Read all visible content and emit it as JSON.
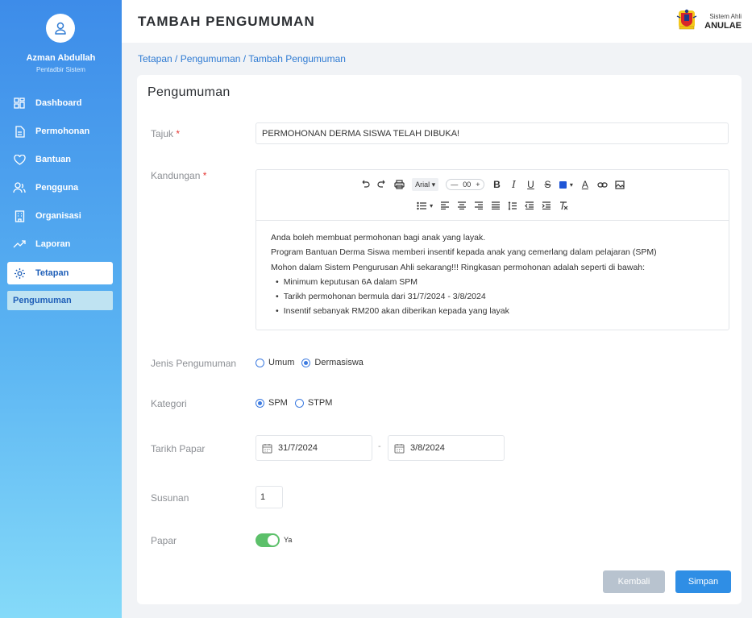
{
  "user": {
    "name": "Azman Abdullah",
    "role": "Pentadbir Sistem"
  },
  "nav": {
    "items": [
      {
        "label": "Dashboard",
        "icon": "dashboard-icon"
      },
      {
        "label": "Permohonan",
        "icon": "document-icon"
      },
      {
        "label": "Bantuan",
        "icon": "heart-icon"
      },
      {
        "label": "Pengguna",
        "icon": "users-icon"
      },
      {
        "label": "Organisasi",
        "icon": "building-icon"
      },
      {
        "label": "Laporan",
        "icon": "trend-icon"
      },
      {
        "label": "Tetapan",
        "icon": "gear-icon",
        "active": true
      }
    ],
    "sub_item": "Pengumuman"
  },
  "header": {
    "title": "TAMBAH PENGUMUMAN",
    "brand_small": "Sistem Ahli",
    "brand_large": "ANULAE"
  },
  "breadcrumb": "Tetapan / Pengumuman / Tambah Pengumuman",
  "form": {
    "title": "Pengumuman",
    "required_mark": "*",
    "tajuk_label": "Tajuk",
    "tajuk_value": "PERMOHONAN DERMA SISWA TELAH DIBUKA!",
    "kandungan_label": "Kandungan",
    "editor": {
      "font": "Arial",
      "font_size": "00",
      "text_color": "#1f56d6",
      "lines": [
        "Anda boleh membuat permohonan bagi anak yang layak.",
        "Program Bantuan Derma Siswa memberi insentif kepada anak yang cemerlang dalam pelajaran (SPM)",
        "Mohon dalam Sistem Pengurusan Ahli sekarang!!! Ringkasan permohonan adalah seperti di bawah:"
      ],
      "bullets": [
        "Minimum keputusan 6A dalam SPM",
        "Tarikh permohonan bermula dari 31/7/2024 - 3/8/2024",
        "Insentif sebanyak RM200 akan diberikan kepada yang layak"
      ]
    },
    "jenis_label": "Jenis Pengumuman",
    "jenis_options": [
      "Umum",
      "Dermasiswa"
    ],
    "jenis_selected": "Dermasiswa",
    "kategori_label": "Kategori",
    "kategori_options": [
      "SPM",
      "STPM"
    ],
    "kategori_selected": "SPM",
    "tarikh_label": "Tarikh Papar",
    "date_from": "31/7/2024",
    "date_to": "3/8/2024",
    "date_separator": "-",
    "susunan_label": "Susunan",
    "susunan_value": "1",
    "papar_label": "Papar",
    "papar_toggle_label": "Ya",
    "papar_on": true,
    "back_label": "Kembali",
    "save_label": "Simpan"
  },
  "colors": {
    "primary": "#2f8ee5",
    "toggle_on": "#5cc06a",
    "required": "#e53935"
  }
}
